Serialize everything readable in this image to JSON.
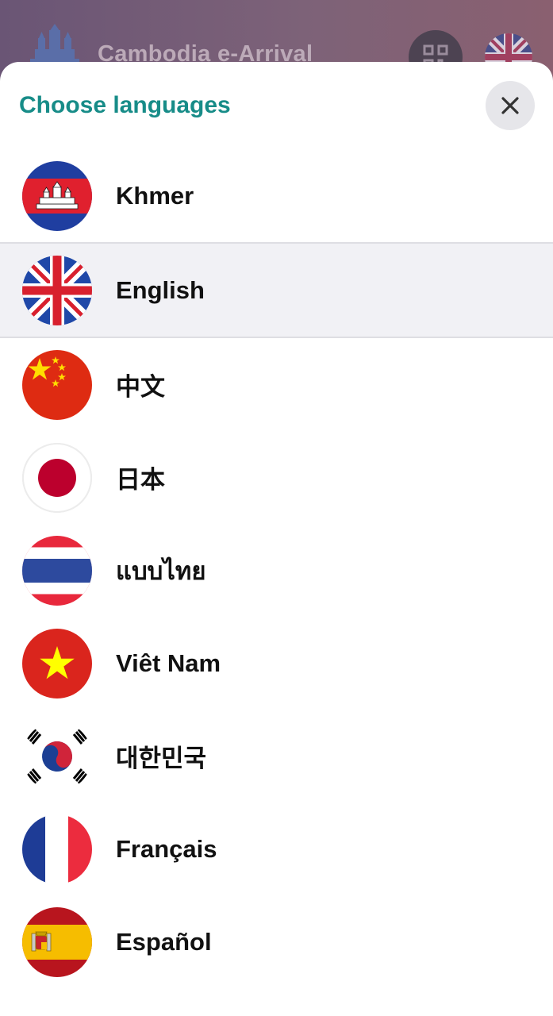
{
  "app": {
    "title": "Cambodia e-Arrival"
  },
  "sheet": {
    "title": "Choose languages",
    "selected": "English",
    "languages": [
      {
        "label": "Khmer",
        "flag": "cambodia-flag-icon"
      },
      {
        "label": "English",
        "flag": "uk-flag-icon"
      },
      {
        "label": "中文",
        "flag": "china-flag-icon"
      },
      {
        "label": "日本",
        "flag": "japan-flag-icon"
      },
      {
        "label": "แบบไทย",
        "flag": "thailand-flag-icon"
      },
      {
        "label": "Viêt Nam",
        "flag": "vietnam-flag-icon"
      },
      {
        "label": "대한민국",
        "flag": "korea-flag-icon"
      },
      {
        "label": "Français",
        "flag": "france-flag-icon"
      },
      {
        "label": "Español",
        "flag": "spain-flag-icon"
      }
    ]
  },
  "colors": {
    "accent": "#178c88",
    "selected_bg": "#f1f1f5"
  }
}
